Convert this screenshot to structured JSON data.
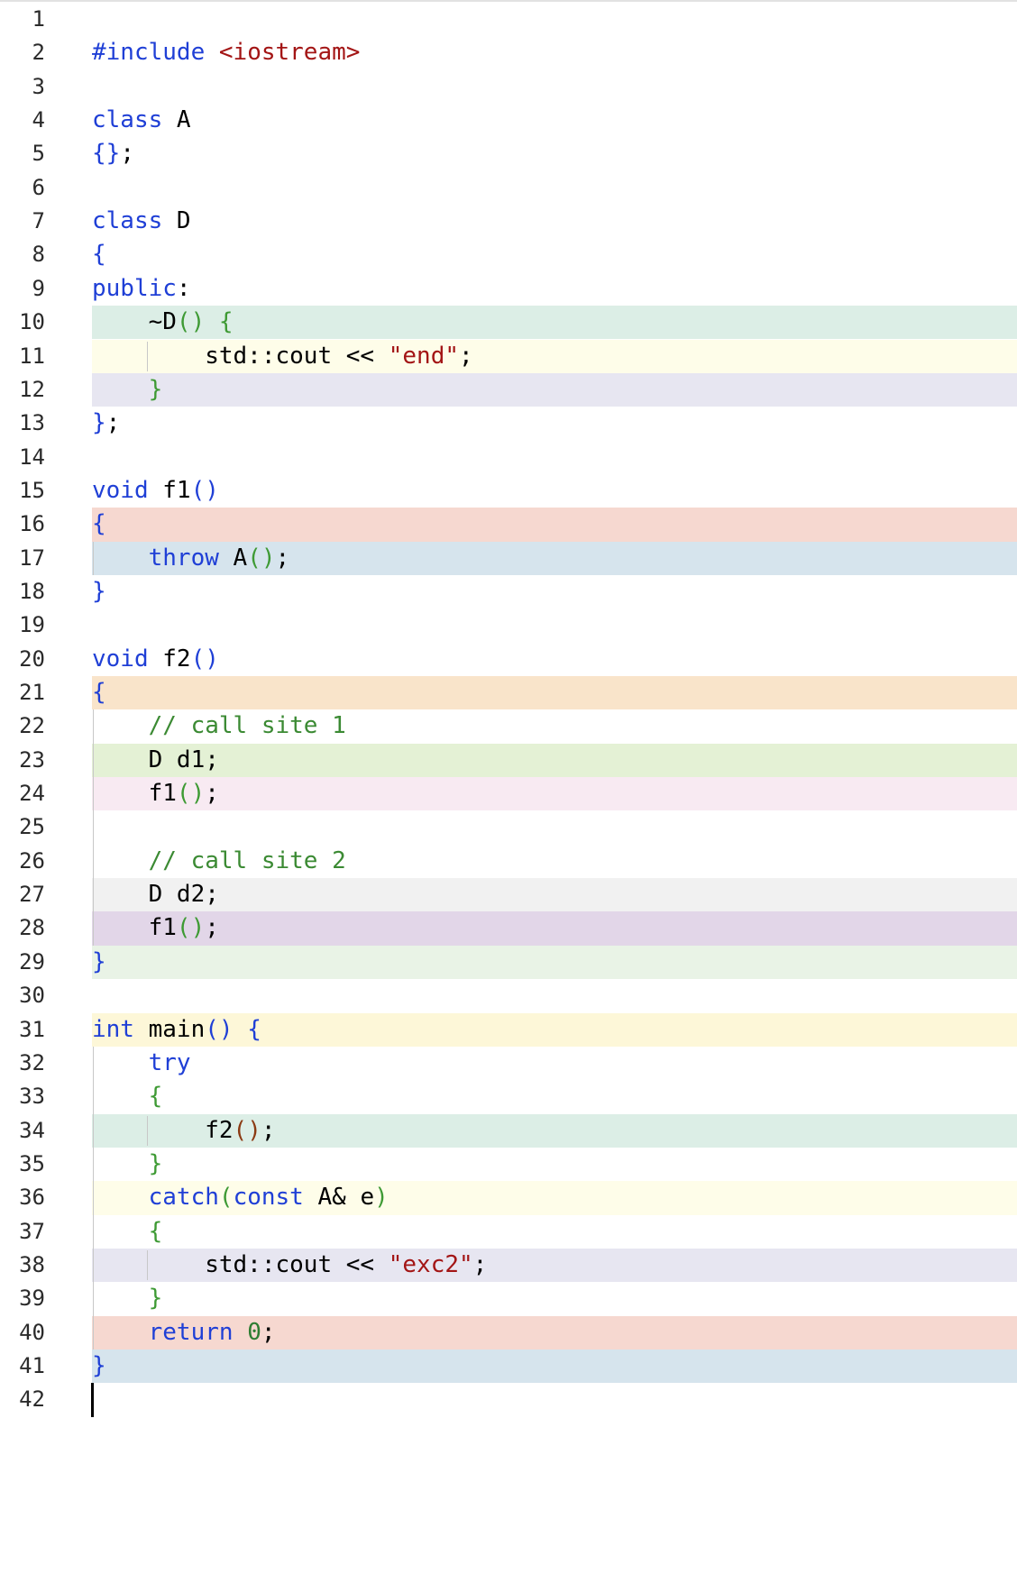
{
  "colors": {
    "teal": "#dceee6",
    "yellow": "#fefde9",
    "lavender": "#e7e6f1",
    "salmon": "#f6d8d0",
    "blue": "#d6e4ed",
    "peach": "#f9e4ca",
    "green": "#e4f1d5",
    "pink": "#f8eaf2",
    "gray": "#f1f1f1",
    "purple": "#e2d6e8",
    "mint": "#e9f3e6",
    "lightyellow": "#fdf7d8"
  },
  "lines": [
    {
      "n": "1",
      "tokens": []
    },
    {
      "n": "2",
      "tokens": [
        {
          "t": "#include ",
          "c": "t-kw"
        },
        {
          "t": "<iostream>",
          "c": "t-str"
        }
      ]
    },
    {
      "n": "3",
      "tokens": []
    },
    {
      "n": "4",
      "tokens": [
        {
          "t": "class ",
          "c": "t-kw"
        },
        {
          "t": "A",
          "c": "t-id"
        }
      ]
    },
    {
      "n": "5",
      "tokens": [
        {
          "t": "{}",
          "c": "t-br-b"
        },
        {
          "t": ";",
          "c": "t-op"
        }
      ]
    },
    {
      "n": "6",
      "tokens": []
    },
    {
      "n": "7",
      "tokens": [
        {
          "t": "class ",
          "c": "t-kw"
        },
        {
          "t": "D",
          "c": "t-id"
        }
      ]
    },
    {
      "n": "8",
      "tokens": [
        {
          "t": "{",
          "c": "t-br-b"
        }
      ]
    },
    {
      "n": "9",
      "tokens": [
        {
          "t": "public",
          "c": "t-kw"
        },
        {
          "t": ":",
          "c": "t-op"
        }
      ]
    },
    {
      "n": "10",
      "bg": "teal",
      "tokens": [
        {
          "t": "    ~D",
          "c": "t-id"
        },
        {
          "t": "()",
          "c": "t-br-g"
        },
        {
          "t": " ",
          "c": "t-id"
        },
        {
          "t": "{",
          "c": "t-br-g"
        }
      ]
    },
    {
      "n": "11",
      "bg": "yellow",
      "tokens": [
        {
          "t": "        std::cout << ",
          "c": "t-id"
        },
        {
          "t": "\"end\"",
          "c": "t-str"
        },
        {
          "t": ";",
          "c": "t-op"
        }
      ]
    },
    {
      "n": "12",
      "bg": "lavender",
      "tokens": [
        {
          "t": "    ",
          "c": "t-id"
        },
        {
          "t": "}",
          "c": "t-br-g"
        }
      ]
    },
    {
      "n": "13",
      "tokens": [
        {
          "t": "}",
          "c": "t-br-b"
        },
        {
          "t": ";",
          "c": "t-op"
        }
      ]
    },
    {
      "n": "14",
      "tokens": []
    },
    {
      "n": "15",
      "tokens": [
        {
          "t": "void ",
          "c": "t-kw"
        },
        {
          "t": "f1",
          "c": "t-id"
        },
        {
          "t": "()",
          "c": "t-br-b"
        }
      ]
    },
    {
      "n": "16",
      "bg": "salmon",
      "tokens": [
        {
          "t": "{",
          "c": "t-br-b"
        }
      ]
    },
    {
      "n": "17",
      "bg": "blue",
      "tokens": [
        {
          "t": "    ",
          "c": "t-id"
        },
        {
          "t": "throw ",
          "c": "t-kw"
        },
        {
          "t": "A",
          "c": "t-id"
        },
        {
          "t": "()",
          "c": "t-br-g"
        },
        {
          "t": ";",
          "c": "t-op"
        }
      ]
    },
    {
      "n": "18",
      "tokens": [
        {
          "t": "}",
          "c": "t-br-b"
        }
      ]
    },
    {
      "n": "19",
      "tokens": []
    },
    {
      "n": "20",
      "tokens": [
        {
          "t": "void ",
          "c": "t-kw"
        },
        {
          "t": "f2",
          "c": "t-id"
        },
        {
          "t": "()",
          "c": "t-br-b"
        }
      ]
    },
    {
      "n": "21",
      "bg": "peach",
      "tokens": [
        {
          "t": "{",
          "c": "t-br-b"
        }
      ]
    },
    {
      "n": "22",
      "tokens": [
        {
          "t": "    ",
          "c": "t-id"
        },
        {
          "t": "// call site 1",
          "c": "t-cm"
        }
      ]
    },
    {
      "n": "23",
      "bg": "green",
      "tokens": [
        {
          "t": "    D d1;",
          "c": "t-id"
        }
      ]
    },
    {
      "n": "24",
      "bg": "pink",
      "tokens": [
        {
          "t": "    f1",
          "c": "t-id"
        },
        {
          "t": "()",
          "c": "t-br-g"
        },
        {
          "t": ";",
          "c": "t-op"
        }
      ]
    },
    {
      "n": "25",
      "tokens": []
    },
    {
      "n": "26",
      "tokens": [
        {
          "t": "    ",
          "c": "t-id"
        },
        {
          "t": "// call site 2",
          "c": "t-cm"
        }
      ]
    },
    {
      "n": "27",
      "bg": "gray",
      "tokens": [
        {
          "t": "    D d2;",
          "c": "t-id"
        }
      ]
    },
    {
      "n": "28",
      "bg": "purple",
      "tokens": [
        {
          "t": "    f1",
          "c": "t-id"
        },
        {
          "t": "()",
          "c": "t-br-g"
        },
        {
          "t": ";",
          "c": "t-op"
        }
      ]
    },
    {
      "n": "29",
      "bg": "mint",
      "tokens": [
        {
          "t": "}",
          "c": "t-br-b"
        }
      ]
    },
    {
      "n": "30",
      "tokens": []
    },
    {
      "n": "31",
      "bg": "lightyellow",
      "tokens": [
        {
          "t": "int ",
          "c": "t-kw"
        },
        {
          "t": "main",
          "c": "t-id"
        },
        {
          "t": "()",
          "c": "t-br-b"
        },
        {
          "t": " ",
          "c": "t-id"
        },
        {
          "t": "{",
          "c": "t-br-b"
        }
      ]
    },
    {
      "n": "32",
      "tokens": [
        {
          "t": "    ",
          "c": "t-id"
        },
        {
          "t": "try",
          "c": "t-kw"
        }
      ]
    },
    {
      "n": "33",
      "tokens": [
        {
          "t": "    ",
          "c": "t-id"
        },
        {
          "t": "{",
          "c": "t-br-g"
        }
      ]
    },
    {
      "n": "34",
      "bg": "teal",
      "tokens": [
        {
          "t": "        f2",
          "c": "t-id"
        },
        {
          "t": "()",
          "c": "t-br-r"
        },
        {
          "t": ";",
          "c": "t-op"
        }
      ]
    },
    {
      "n": "35",
      "tokens": [
        {
          "t": "    ",
          "c": "t-id"
        },
        {
          "t": "}",
          "c": "t-br-g"
        }
      ]
    },
    {
      "n": "36",
      "bg": "yellow",
      "tokens": [
        {
          "t": "    ",
          "c": "t-id"
        },
        {
          "t": "catch",
          "c": "t-kw"
        },
        {
          "t": "(",
          "c": "t-br-g"
        },
        {
          "t": "const ",
          "c": "t-kw"
        },
        {
          "t": "A& e",
          "c": "t-id"
        },
        {
          "t": ")",
          "c": "t-br-g"
        }
      ]
    },
    {
      "n": "37",
      "tokens": [
        {
          "t": "    ",
          "c": "t-id"
        },
        {
          "t": "{",
          "c": "t-br-g"
        }
      ]
    },
    {
      "n": "38",
      "bg": "lavender",
      "tokens": [
        {
          "t": "        std::cout << ",
          "c": "t-id"
        },
        {
          "t": "\"exc2\"",
          "c": "t-str"
        },
        {
          "t": ";",
          "c": "t-op"
        }
      ]
    },
    {
      "n": "39",
      "tokens": [
        {
          "t": "    ",
          "c": "t-id"
        },
        {
          "t": "}",
          "c": "t-br-g"
        }
      ]
    },
    {
      "n": "40",
      "bg": "salmon",
      "tokens": [
        {
          "t": "    ",
          "c": "t-id"
        },
        {
          "t": "return ",
          "c": "t-kw"
        },
        {
          "t": "0",
          "c": "t-num"
        },
        {
          "t": ";",
          "c": "t-op"
        }
      ]
    },
    {
      "n": "41",
      "bg": "blue",
      "tokens": [
        {
          "t": "}",
          "c": "t-br-b"
        }
      ]
    },
    {
      "n": "42",
      "cursor": true,
      "tokens": []
    }
  ]
}
